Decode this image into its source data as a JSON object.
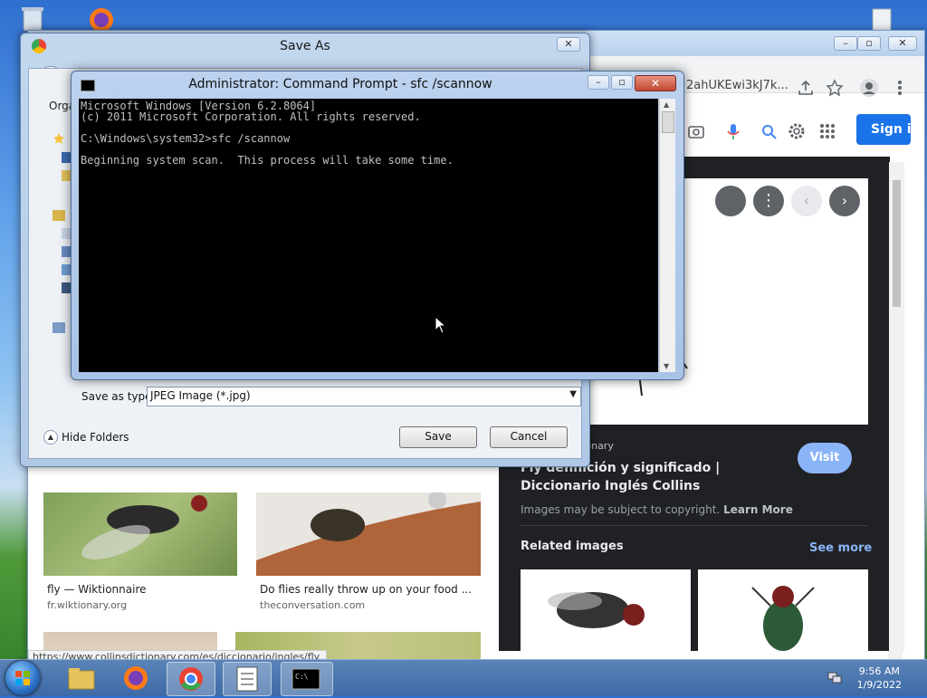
{
  "chrome": {
    "address_fragment": "2ahUKEwi3kJ7k...",
    "sign_in_label": "Sign in",
    "status_url": "https://www.collinsdictionary.com/es/diccionario/ingles/fly..."
  },
  "results": [
    {
      "caption": "fly — Wiktionnaire",
      "source": "fr.wiktionary.org"
    },
    {
      "caption": "Do flies really throw up on your food ...",
      "source": "theconversation.com"
    }
  ],
  "panel": {
    "source_label": "tionary",
    "visit_label": "Visit",
    "title": "Fly definición y significado | Diccionario Inglés Collins",
    "copyright": "Images may be subject to copyright.",
    "learn_more": "Learn More",
    "related_label": "Related images",
    "see_more": "See more"
  },
  "saveas": {
    "title": "Save As",
    "organize_label": "Orga",
    "save_as_type_label": "Save as type:",
    "save_as_type_value": "JPEG Image (*.jpg)",
    "hide_folders": "Hide Folders",
    "save_button": "Save",
    "cancel_button": "Cancel"
  },
  "cmd": {
    "title": "Administrator: Command Prompt - sfc  /scannow",
    "lines": [
      "Microsoft Windows [Version 6.2.8064]",
      "(c) 2011 Microsoft Corporation. All rights reserved.",
      "",
      "C:\\Windows\\system32>sfc /scannow",
      "",
      "Beginning system scan.  This process will take some time."
    ]
  },
  "taskbar": {
    "time": "9:56 AM",
    "date": "1/9/2022"
  },
  "colors": {
    "google_blue": "#1a73e8",
    "visit_button": "#8ab4f8",
    "panel_bg": "#202124"
  }
}
